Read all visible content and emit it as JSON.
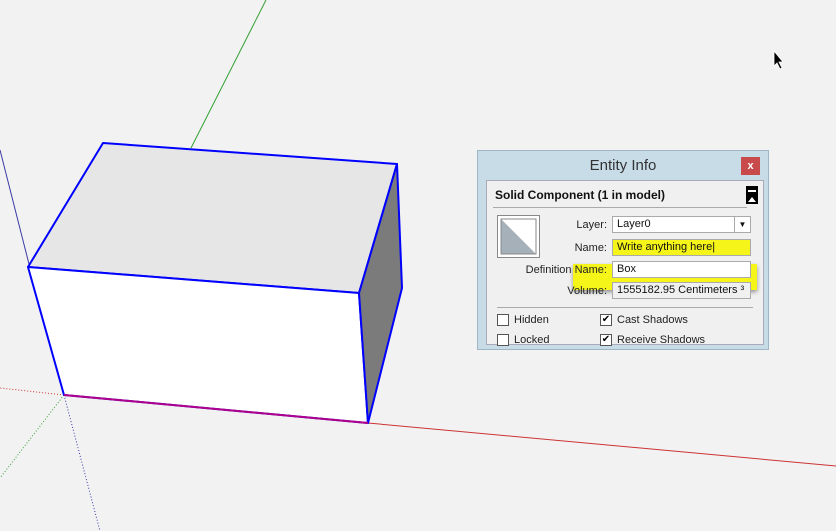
{
  "dialog": {
    "title": "Entity Info",
    "close_label": "x",
    "header": "Solid Component (1 in model)",
    "layer_label": "Layer:",
    "layer_value": "Layer0",
    "name_label": "Name:",
    "name_value": "Write anything here",
    "definition_label": "Definition Name:",
    "definition_value": "Box",
    "volume_label": "Volume:",
    "volume_value": "1555182.95 Centimeters ³",
    "checkboxes": [
      {
        "label": "Hidden",
        "checked": false
      },
      {
        "label": "Locked",
        "checked": false
      },
      {
        "label": "Cast Shadows",
        "checked": true
      },
      {
        "label": "Receive Shadows",
        "checked": true
      }
    ]
  },
  "colors": {
    "selection": "#0000ff",
    "highlight": "#f5f51a",
    "x_axis": "#cc0000",
    "y_axis": "#00a000"
  }
}
